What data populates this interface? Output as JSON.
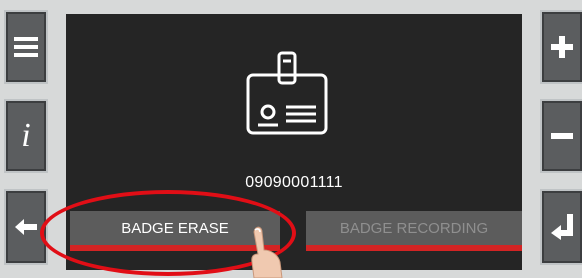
{
  "left_controls": [
    {
      "id": "menu",
      "icon": "menu-icon"
    },
    {
      "id": "info",
      "icon": "info-icon"
    },
    {
      "id": "back",
      "icon": "arrow-left-icon"
    }
  ],
  "right_controls": [
    {
      "id": "plus",
      "icon": "plus-icon"
    },
    {
      "id": "minus",
      "icon": "minus-icon"
    },
    {
      "id": "enter",
      "icon": "enter-return-icon"
    }
  ],
  "screen": {
    "icon": "id-badge-icon",
    "badge_number": "09090001111",
    "buttons": {
      "erase_label": "BADGE ERASE",
      "recording_label": "BADGE RECORDING"
    }
  },
  "colors": {
    "screen_bg": "#252525",
    "button_bg": "#5c5c5c",
    "accent_red": "#d32424",
    "highlight_red": "#e10e16"
  }
}
